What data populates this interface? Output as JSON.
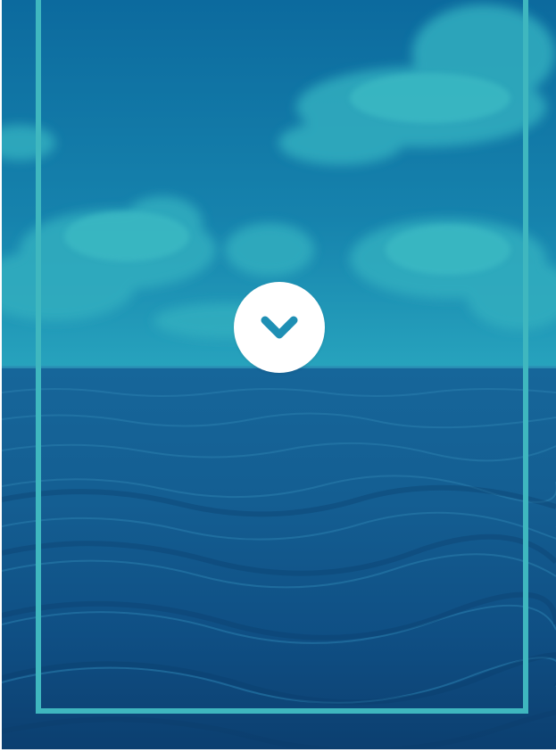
{
  "hero": {
    "background": "ocean-horizon-photo",
    "tint_color": "#1a6fa0",
    "frame_color": "#3fb7bf",
    "scroll_button": {
      "icon": "chevron-down-icon",
      "background_color": "#ffffff",
      "icon_color": "#1e8fb4"
    }
  }
}
